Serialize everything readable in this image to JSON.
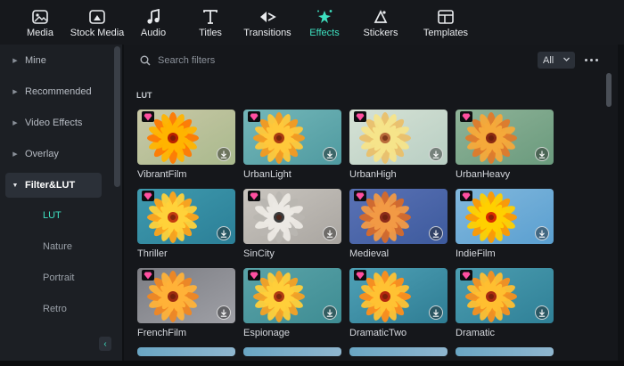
{
  "toolbar": {
    "items": [
      {
        "label": "Media",
        "icon": "media-icon"
      },
      {
        "label": "Stock Media",
        "icon": "stock-media-icon"
      },
      {
        "label": "Audio",
        "icon": "music-note-icon"
      },
      {
        "label": "Titles",
        "icon": "text-t-icon"
      },
      {
        "label": "Transitions",
        "icon": "transitions-icon"
      },
      {
        "label": "Effects",
        "icon": "effects-sparkle-icon",
        "active": true
      },
      {
        "label": "Stickers",
        "icon": "stickers-icon"
      },
      {
        "label": "Templates",
        "icon": "templates-icon"
      }
    ]
  },
  "sidebar": {
    "items": [
      {
        "label": "Mine"
      },
      {
        "label": "Recommended"
      },
      {
        "label": "Video Effects"
      },
      {
        "label": "Overlay"
      },
      {
        "label": "Filter&LUT",
        "expanded": true
      }
    ],
    "subitems": [
      {
        "label": "LUT",
        "active": true
      },
      {
        "label": "Nature"
      },
      {
        "label": "Portrait"
      },
      {
        "label": "Retro"
      }
    ],
    "collapse_glyph": "‹"
  },
  "search": {
    "placeholder": "Search filters",
    "filter_value": "All"
  },
  "section": {
    "title": "LUT"
  },
  "filters": [
    {
      "name": "VibrantFilm",
      "style": "vibrant"
    },
    {
      "name": "UrbanLight",
      "style": "urbanlight"
    },
    {
      "name": "UrbanHigh",
      "style": "urbanhigh"
    },
    {
      "name": "UrbanHeavy",
      "style": "urbanheavy"
    },
    {
      "name": "Thriller",
      "style": "thriller"
    },
    {
      "name": "SinCity",
      "style": "sincity"
    },
    {
      "name": "Medieval",
      "style": "medieval"
    },
    {
      "name": "IndieFilm",
      "style": "indie"
    },
    {
      "name": "FrenchFilm",
      "style": "french"
    },
    {
      "name": "Espionage",
      "style": "espionage"
    },
    {
      "name": "DramaticTwo",
      "style": "dramatictwo"
    },
    {
      "name": "Dramatic",
      "style": "dramatic"
    }
  ],
  "colors": {
    "accent": "#3ee0c0",
    "premium_badge": "#ff4fa0",
    "panel_bg": "#15171b",
    "sidebar_bg": "#1c1f24"
  }
}
